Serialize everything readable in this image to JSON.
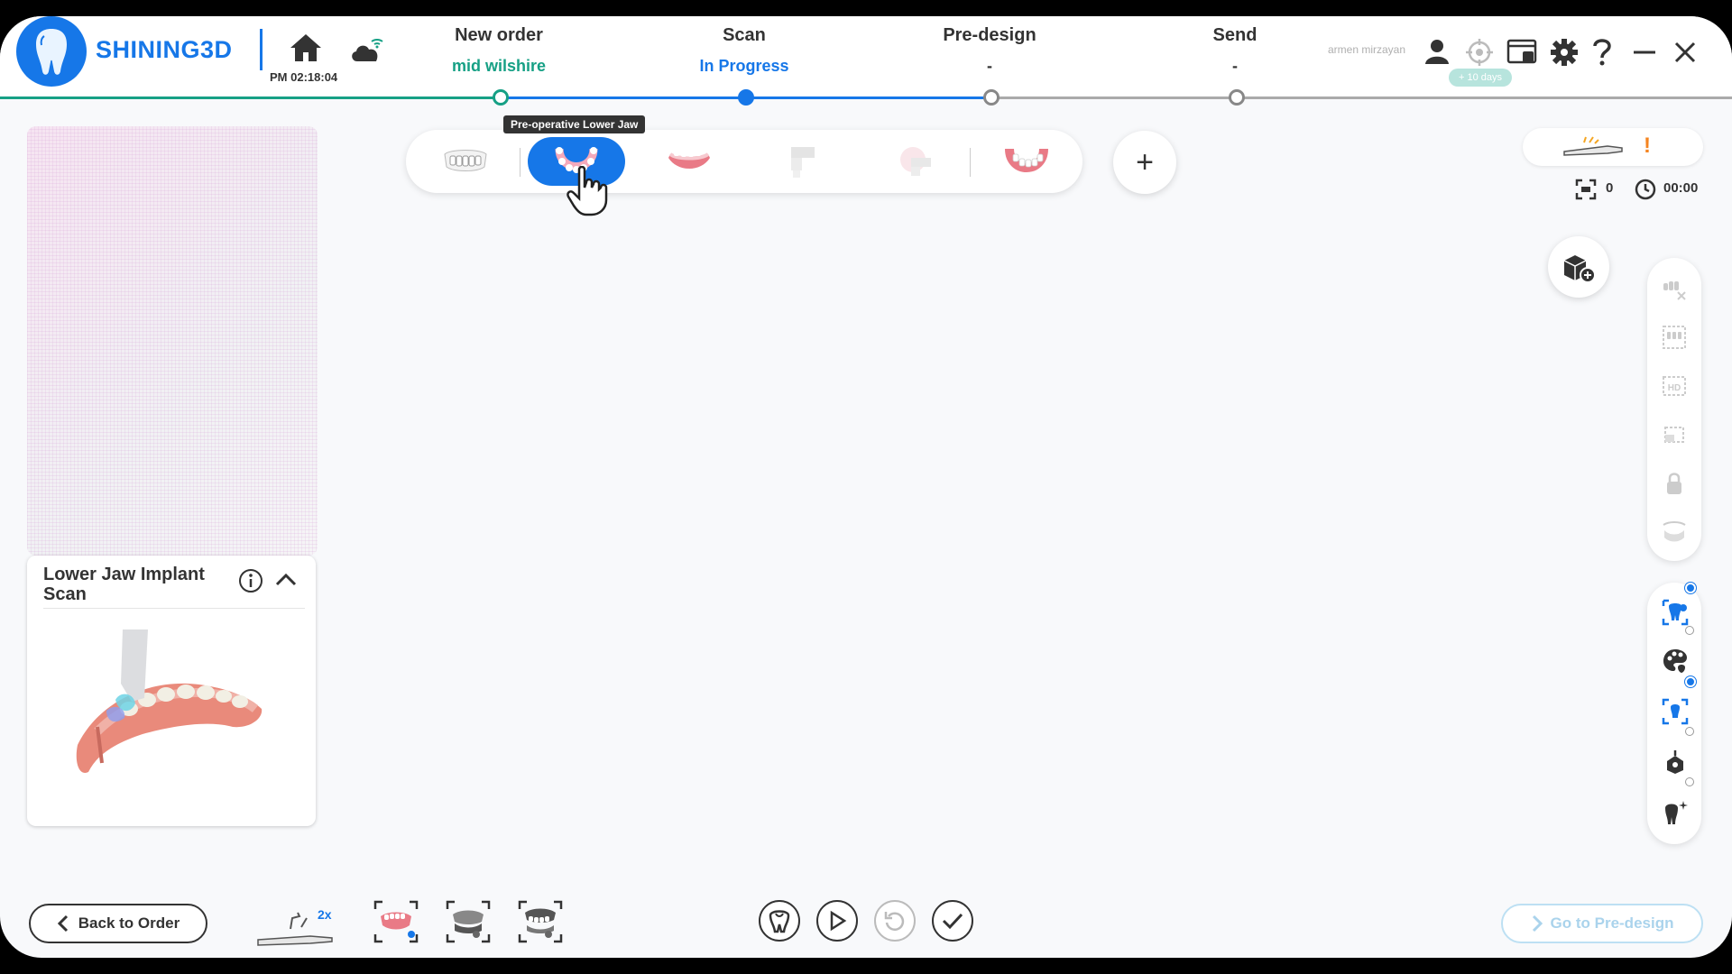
{
  "app": {
    "name": "SHINING3D",
    "time": "PM 02:18:04",
    "user": "armen mirzayan",
    "trial_badge": "+ 10 days"
  },
  "steps": [
    {
      "title": "New order",
      "sub": "mid wilshire",
      "sub_color": "#16a085"
    },
    {
      "title": "Scan",
      "sub": "In Progress",
      "sub_color": "#1677e8"
    },
    {
      "title": "Pre-design",
      "sub": "-",
      "sub_color": "#333333"
    },
    {
      "title": "Send",
      "sub": "-",
      "sub_color": "#333333"
    }
  ],
  "toolbar": {
    "tooltip": "Pre-operative Lower Jaw",
    "add_label": "+"
  },
  "status": {
    "scan_count": "0",
    "timer": "00:00",
    "alert": "!"
  },
  "info_card": {
    "title": "Lower Jaw Implant Scan"
  },
  "bottom": {
    "back_label": "Back to Order",
    "next_label": "Go to Pre-design",
    "speed_label": "2x"
  },
  "colors": {
    "accent": "#1677e8",
    "teal": "#16a085",
    "disabled": "#aad3ec"
  }
}
